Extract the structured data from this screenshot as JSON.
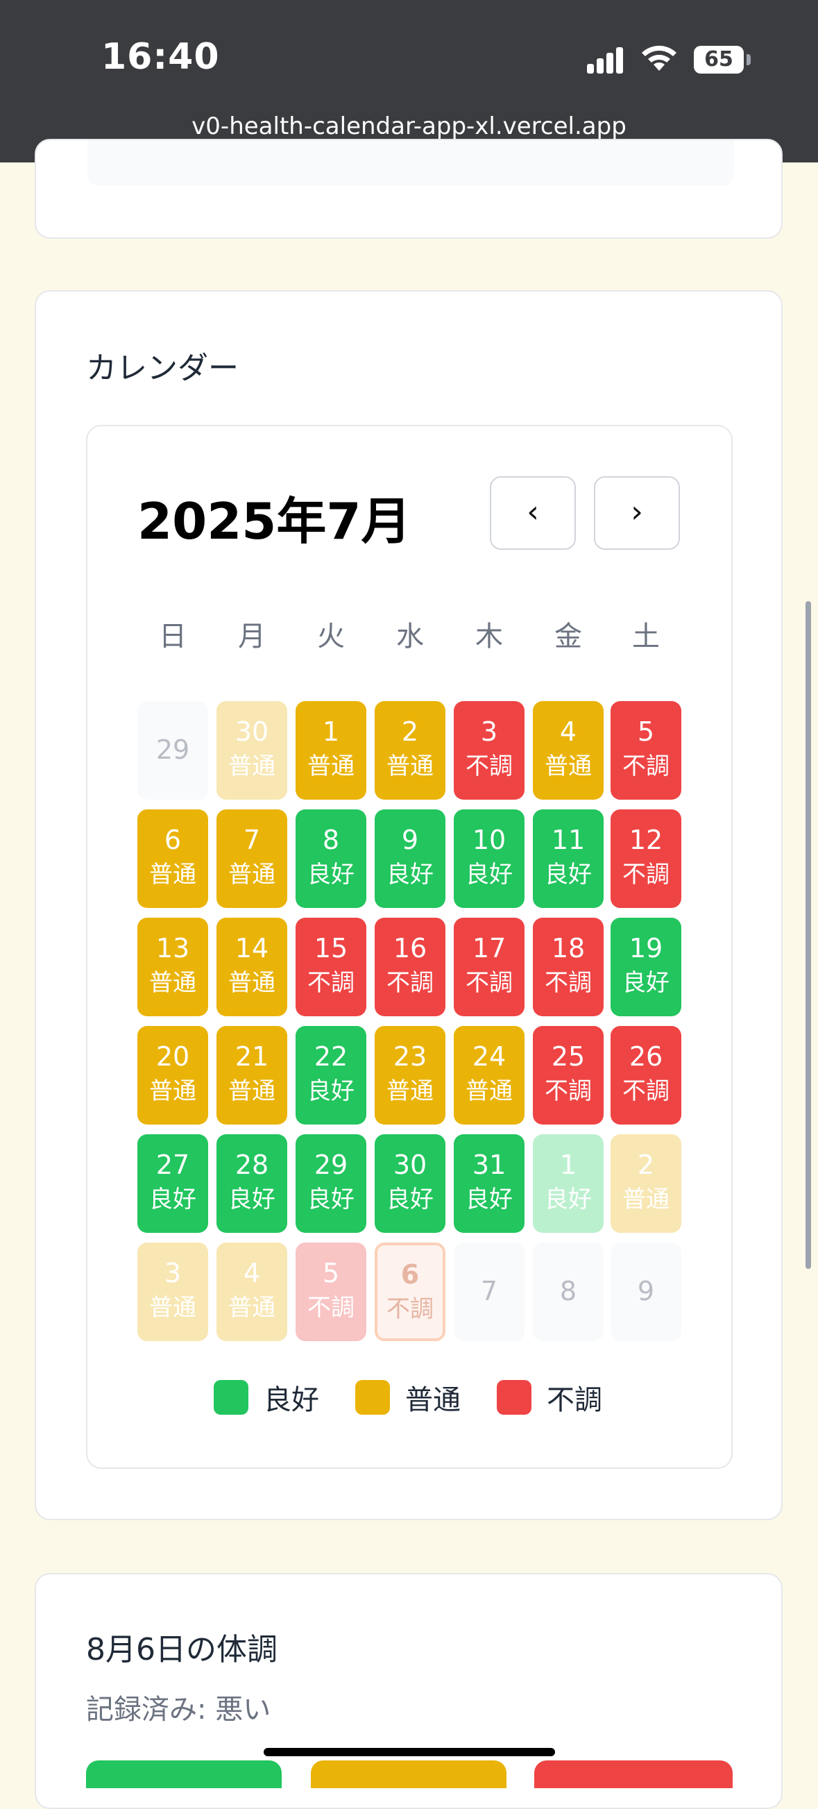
{
  "status": {
    "time": "16:40",
    "battery": "65",
    "url": "v0-health-calendar-app-xl.vercel.app"
  },
  "calendar_section": {
    "title": "カレンダー",
    "month_label": "2025年7月",
    "prev": "‹",
    "next": "›",
    "weekdays": [
      "日",
      "月",
      "火",
      "水",
      "木",
      "金",
      "土"
    ],
    "weeks": [
      [
        {
          "d": "29",
          "s": "",
          "t": "blank"
        },
        {
          "d": "30",
          "s": "普通",
          "t": "dim-normal"
        },
        {
          "d": "1",
          "s": "普通",
          "t": "normal"
        },
        {
          "d": "2",
          "s": "普通",
          "t": "normal"
        },
        {
          "d": "3",
          "s": "不調",
          "t": "bad"
        },
        {
          "d": "4",
          "s": "普通",
          "t": "normal"
        },
        {
          "d": "5",
          "s": "不調",
          "t": "bad"
        }
      ],
      [
        {
          "d": "6",
          "s": "普通",
          "t": "normal"
        },
        {
          "d": "7",
          "s": "普通",
          "t": "normal"
        },
        {
          "d": "8",
          "s": "良好",
          "t": "good"
        },
        {
          "d": "9",
          "s": "良好",
          "t": "good"
        },
        {
          "d": "10",
          "s": "良好",
          "t": "good"
        },
        {
          "d": "11",
          "s": "良好",
          "t": "good"
        },
        {
          "d": "12",
          "s": "不調",
          "t": "bad"
        }
      ],
      [
        {
          "d": "13",
          "s": "普通",
          "t": "normal"
        },
        {
          "d": "14",
          "s": "普通",
          "t": "normal"
        },
        {
          "d": "15",
          "s": "不調",
          "t": "bad"
        },
        {
          "d": "16",
          "s": "不調",
          "t": "bad"
        },
        {
          "d": "17",
          "s": "不調",
          "t": "bad"
        },
        {
          "d": "18",
          "s": "不調",
          "t": "bad"
        },
        {
          "d": "19",
          "s": "良好",
          "t": "good"
        }
      ],
      [
        {
          "d": "20",
          "s": "普通",
          "t": "normal"
        },
        {
          "d": "21",
          "s": "普通",
          "t": "normal"
        },
        {
          "d": "22",
          "s": "良好",
          "t": "good"
        },
        {
          "d": "23",
          "s": "普通",
          "t": "normal"
        },
        {
          "d": "24",
          "s": "普通",
          "t": "normal"
        },
        {
          "d": "25",
          "s": "不調",
          "t": "bad"
        },
        {
          "d": "26",
          "s": "不調",
          "t": "bad"
        }
      ],
      [
        {
          "d": "27",
          "s": "良好",
          "t": "good"
        },
        {
          "d": "28",
          "s": "良好",
          "t": "good"
        },
        {
          "d": "29",
          "s": "良好",
          "t": "good"
        },
        {
          "d": "30",
          "s": "良好",
          "t": "good"
        },
        {
          "d": "31",
          "s": "良好",
          "t": "good"
        },
        {
          "d": "1",
          "s": "良好",
          "t": "dim-good"
        },
        {
          "d": "2",
          "s": "普通",
          "t": "dim-normal"
        }
      ],
      [
        {
          "d": "3",
          "s": "普通",
          "t": "dim-normal"
        },
        {
          "d": "4",
          "s": "普通",
          "t": "dim-normal"
        },
        {
          "d": "5",
          "s": "不調",
          "t": "dim-bad"
        },
        {
          "d": "6",
          "s": "不調",
          "t": "today"
        },
        {
          "d": "7",
          "s": "",
          "t": "blank"
        },
        {
          "d": "8",
          "s": "",
          "t": "blank"
        },
        {
          "d": "9",
          "s": "",
          "t": "blank"
        }
      ]
    ],
    "legend": [
      {
        "label": "良好",
        "color": "#22c55e"
      },
      {
        "label": "普通",
        "color": "#eab308"
      },
      {
        "label": "不調",
        "color": "#ef4444"
      }
    ]
  },
  "detail_section": {
    "title": "8月6日の体調",
    "recorded": "記録済み: 悪い"
  }
}
